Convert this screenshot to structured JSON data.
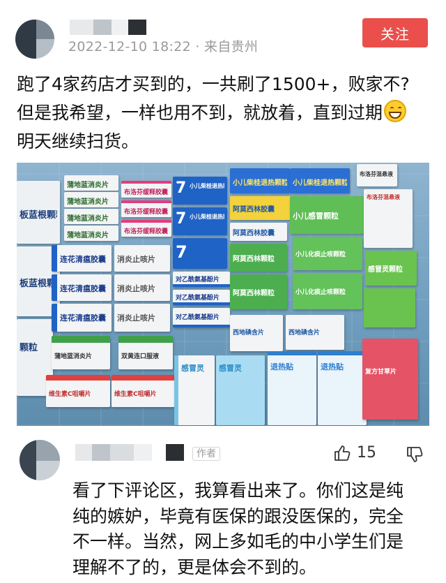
{
  "post": {
    "timestamp": "2022-12-10 18:22 · 来自贵州",
    "follow_label": "关注",
    "text_lines": [
      "跑了4家药店才买到的，一共刷了1500+，败家不?",
      "但是我希望，一样也用不到，就放着，直到过期",
      "明天继续扫货。"
    ],
    "emoji_icon": "grinning-face-icon"
  },
  "photo": {
    "box_labels": {
      "sachet_left_1": "板蓝根颗粒",
      "sachet_left_2": "板蓝根颗粒",
      "sachet_left_3": "颗粒",
      "pudi_1": "蒲地蓝消炎片",
      "pudi_2": "蒲地蓝消炎片",
      "pudi_3": "蒲地蓝消炎片",
      "pudi_4": "蒲地蓝消炎片",
      "lianhua_1": "连花清瘟胶囊",
      "lianhua_2": "连花清瘟胶囊",
      "lianhua_3": "连花清瘟胶囊",
      "xiaoyan_1": "消炎止咳片",
      "xiaoyan_2": "消炎止咳片",
      "xiaoyan_3": "消炎止咳片",
      "buluofen_1": "布洛芬缓释胶囊",
      "buluofen_2": "布洛芬缓释胶囊",
      "buluofen_3": "布洛芬缓释胶囊",
      "duiyixian_1": "对乙酰氨基酚片",
      "duiyixian_2": "对乙酰氨基酚片",
      "duiyixian_3": "对乙酰氨基酚片",
      "chaihu_1": "小儿柴桂退热颗粒",
      "chaihu_2": "小儿柴桂退热颗粒",
      "amoxi_1": "阿莫西林胶囊",
      "amoxi_2": "阿莫西林颗粒",
      "amoxi_3": "阿莫西林颗粒",
      "ganmao_1": "小儿感冒颗粒",
      "ganmao_2": "感冒灵颗粒",
      "zhike_1": "小儿化痰止咳颗粒",
      "zhike_2": "小儿化痰止咳颗粒",
      "buluofen_suspension": "布洛芬混悬液",
      "buluofen_suspension_2": "布洛芬混悬液",
      "xidi_1": "西地碘含片",
      "xidi_2": "西地碘含片",
      "tuire_1": "退热贴",
      "tuire_2": "退热贴",
      "ganmaoling": "感冒灵",
      "vitamin_1": "维生素C咀嚼片",
      "vitamin_2": "维生素C咀嚼片",
      "shuanghuang_1": "双黄连口服液",
      "pudi_5": "蒲地蓝消炎片",
      "red_box": "复方甘草片"
    }
  },
  "comment": {
    "author_tag": "作者",
    "like_count": "15",
    "text_lines": [
      "看了下评论区，我算看出来了。你们这是纯",
      "纯的嫉妒，毕竟有医保的跟没医保的，完全",
      "不一样。当然，网上多如毛的中小学生们是",
      "理解不了的，更是体会不到的。"
    ]
  },
  "colors": {
    "follow_button": "#ea4f4b",
    "timestamp": "#9a9a9a"
  }
}
